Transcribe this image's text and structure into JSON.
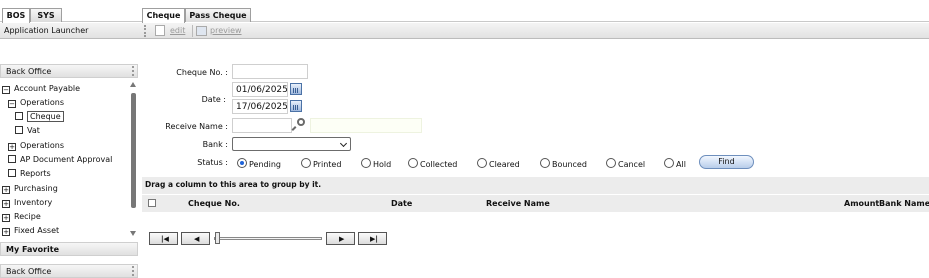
{
  "left_tabs": [
    {
      "label": "BOS"
    },
    {
      "label": "SYS"
    }
  ],
  "app_launcher": "Application Launcher",
  "left_panel": {
    "header": "Back Office",
    "tree": [
      {
        "label": "Account Payable",
        "box": "−"
      },
      {
        "label": "Operations",
        "box": "−"
      },
      {
        "label": "Cheque",
        "box": ""
      },
      {
        "label": "Vat",
        "box": ""
      },
      {
        "label": "Operations",
        "box": "+"
      },
      {
        "label": "AP Document Approval",
        "box": ""
      },
      {
        "label": "Reports",
        "box": ""
      },
      {
        "label": "Purchasing",
        "box": "+"
      },
      {
        "label": "Inventory",
        "box": "+"
      },
      {
        "label": "Recipe",
        "box": "+"
      },
      {
        "label": "Fixed Asset",
        "box": "+"
      }
    ],
    "favorite_header": "My Favorite",
    "bottom_header": "Back Office"
  },
  "right_tabs": [
    {
      "label": "Cheque"
    },
    {
      "label": "Pass Cheque"
    }
  ],
  "toolbar": {
    "edit": "edit",
    "preview": "preview"
  },
  "form": {
    "cheque_no_label": "Cheque No. :",
    "cheque_no_value": "",
    "date_label": "Date :",
    "date_from": "01/06/2025",
    "date_to": "17/06/2025",
    "receive_name_label": "Receive Name :",
    "receive_name_value": "",
    "bank_label": "Bank :",
    "bank_value": "",
    "status_label": "Status :",
    "statuses": [
      "Pending",
      "Printed",
      "Hold",
      "Collected",
      "Cleared",
      "Bounced",
      "Cancel",
      "All"
    ],
    "selected_status": "Pending",
    "find_label": "Find"
  },
  "grid": {
    "group_hint": "Drag a column to this area to group by it.",
    "columns": [
      "Cheque No.",
      "Date",
      "Receive Name",
      "Amount",
      "Bank Name"
    ]
  },
  "pager": {
    "buttons": [
      "first",
      "prev",
      "next",
      "last"
    ]
  },
  "colors": {
    "selected_radio": "#1f63d8",
    "find_button": "#b8cdea"
  }
}
